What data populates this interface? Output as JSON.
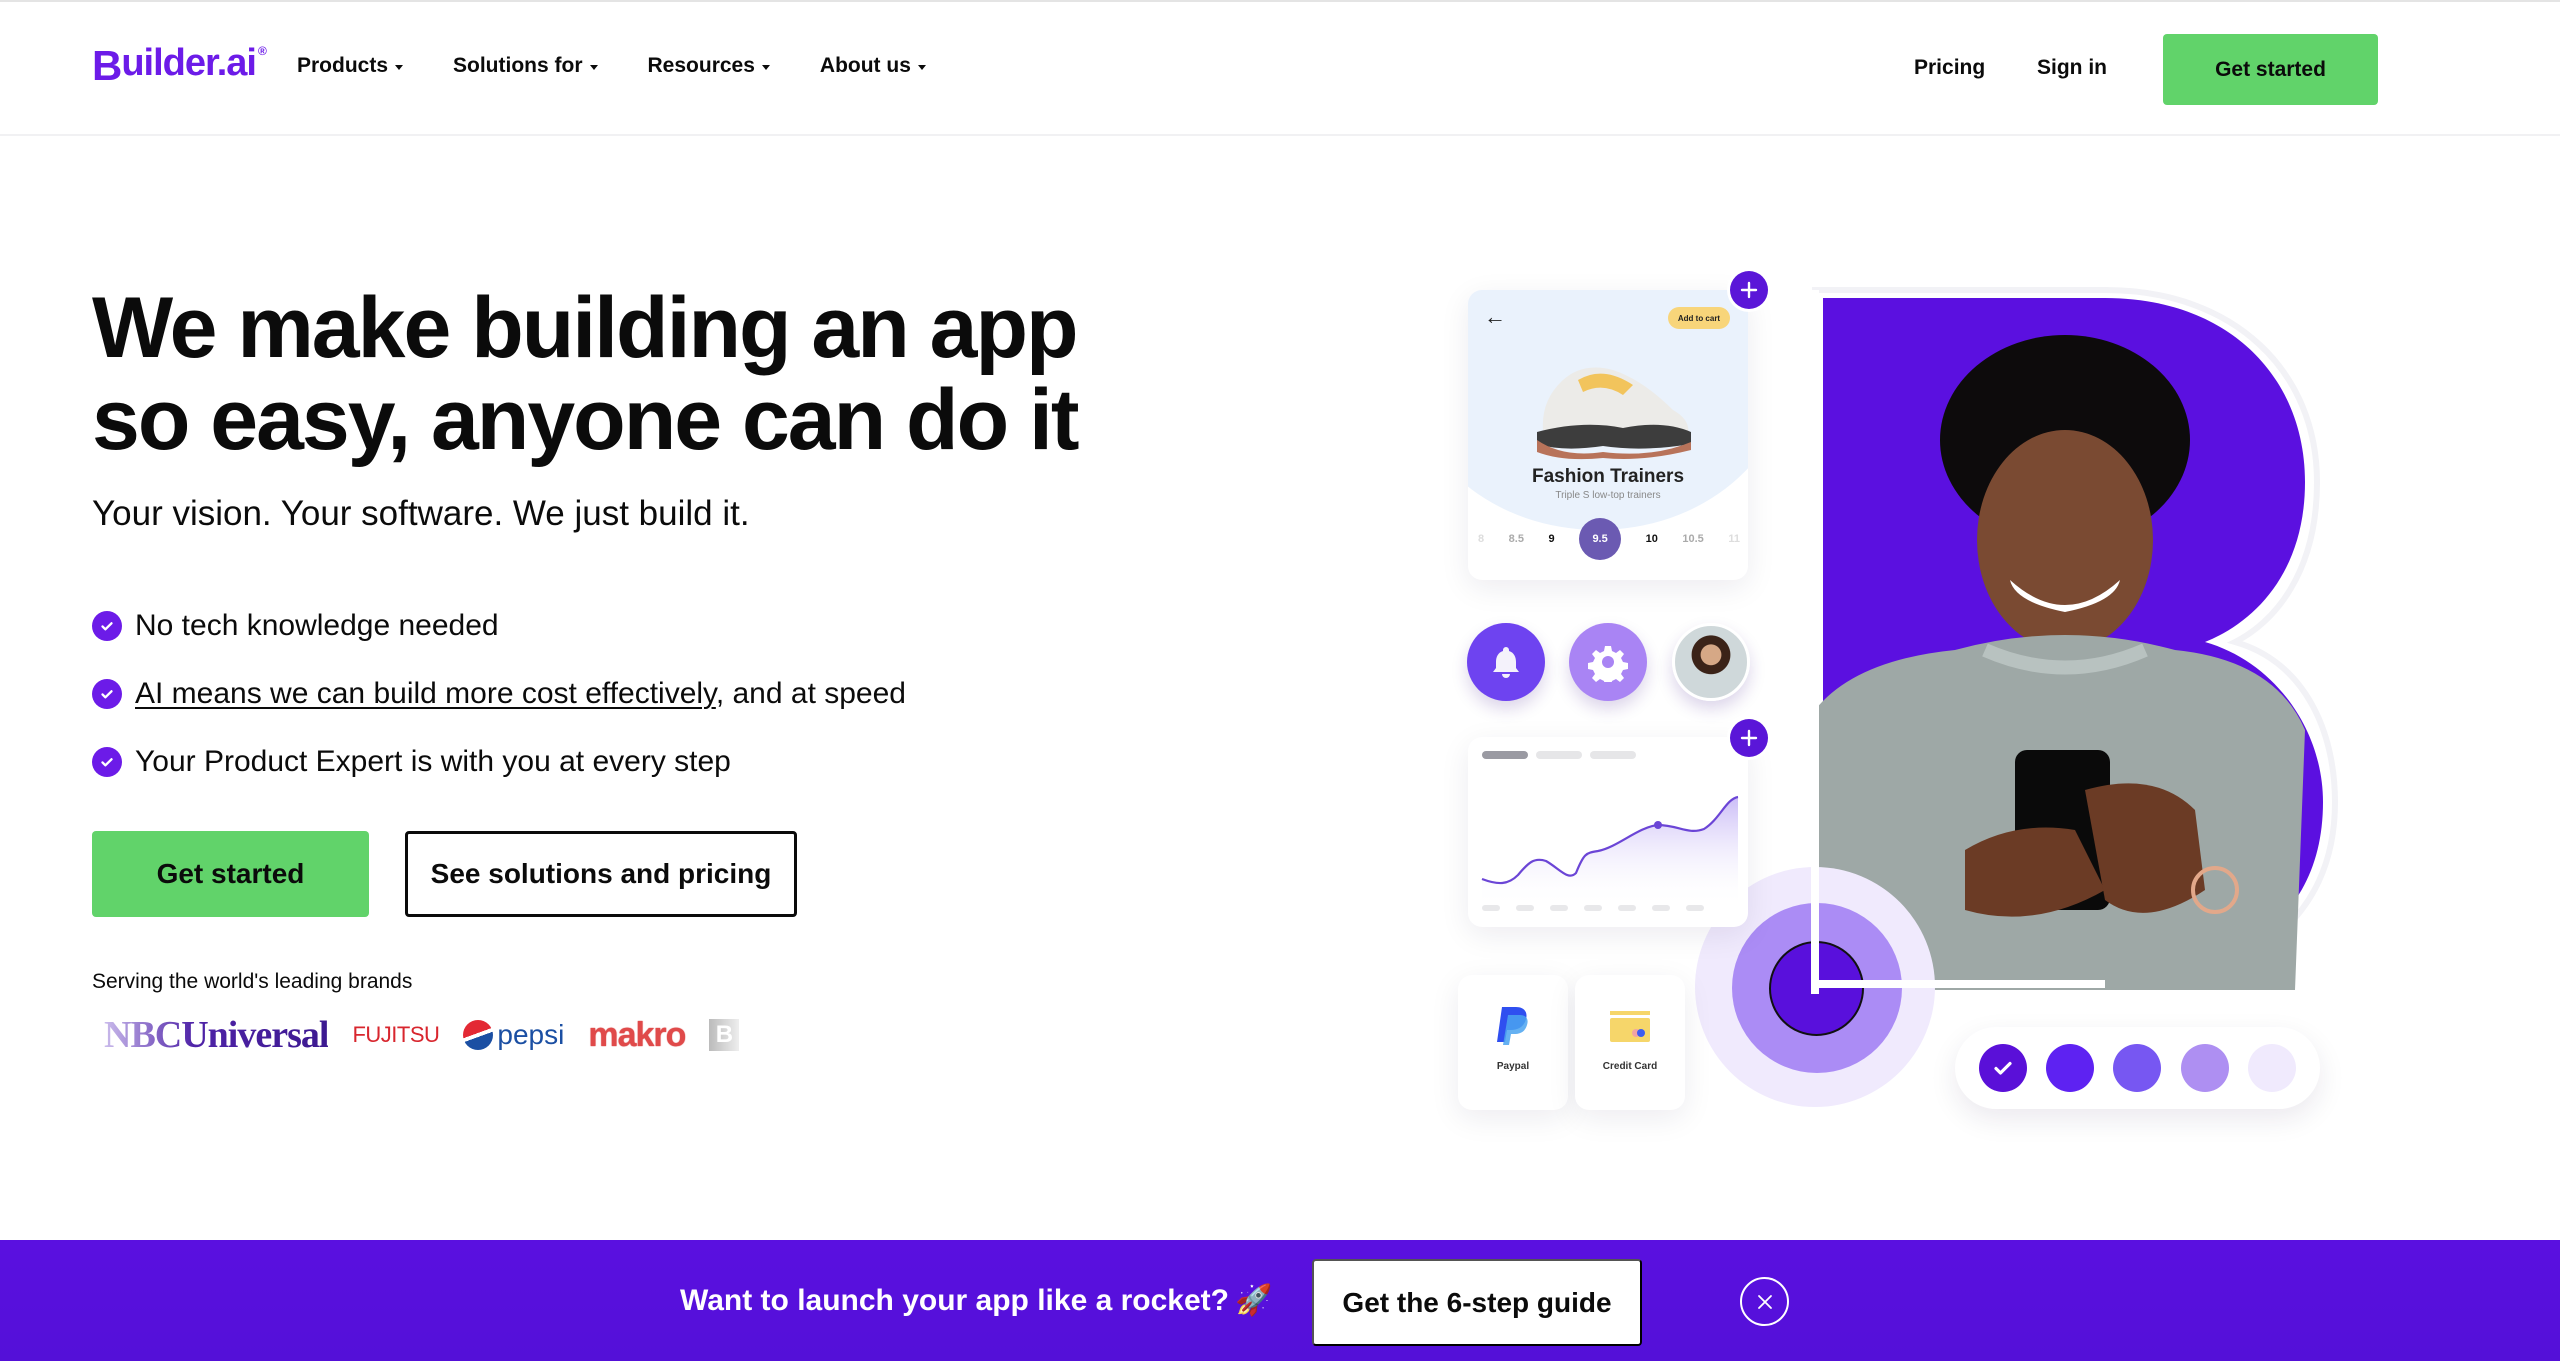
{
  "header": {
    "logo_text": "uilder.ai",
    "logo_initial": "B",
    "logo_reg": "®",
    "nav": [
      {
        "label": "Products"
      },
      {
        "label": "Solutions for"
      },
      {
        "label": "Resources"
      },
      {
        "label": "About us"
      }
    ],
    "pricing_label": "Pricing",
    "signin_label": "Sign in",
    "cta_label": "Get started"
  },
  "hero": {
    "title": "We make building an app so easy, anyone can do it",
    "subtitle": "Your vision. Your software. We just build it.",
    "bullets": [
      {
        "text": "No tech knowledge needed",
        "link": "",
        "suffix": ""
      },
      {
        "text": "",
        "link": "AI means we can build more cost effectively",
        "suffix": ", and at speed"
      },
      {
        "text": "Your Product Expert is with you at every step",
        "link": "",
        "suffix": ""
      }
    ],
    "primary_cta": "Get started",
    "secondary_cta": "See solutions and pricing",
    "brands_label": "Serving the world's leading brands",
    "brands": [
      "NBCUniversal",
      "FUJITSU",
      "pepsi",
      "makro",
      "B"
    ]
  },
  "illustration": {
    "product_card": {
      "add_to_cart": "Add to cart",
      "name": "Fashion Trainers",
      "subtitle": "Triple S low-top trainers",
      "sizes": [
        "8",
        "8.5",
        "9",
        "9.5",
        "10",
        "10.5",
        "11"
      ],
      "selected_size": "9.5"
    },
    "icons": [
      "bell-icon",
      "gear-icon",
      "user-avatar"
    ],
    "payment_methods": [
      {
        "label": "Paypal",
        "icon": "paypal-icon"
      },
      {
        "label": "Credit Card",
        "icon": "credit-card-icon"
      }
    ],
    "swatches": [
      "#5a10d8",
      "#5e22f2",
      "#7757f2",
      "#ae8ff2",
      "#f0eafd"
    ],
    "selected_swatch": 0
  },
  "banner": {
    "text": "Want to launch your app like a rocket?",
    "emoji": "🚀",
    "cta": "Get the 6-step guide",
    "close_label": "X"
  },
  "colors": {
    "brand_purple": "#6c1be8",
    "cta_green": "#61d36a",
    "banner_purple": "#5a10e0"
  }
}
